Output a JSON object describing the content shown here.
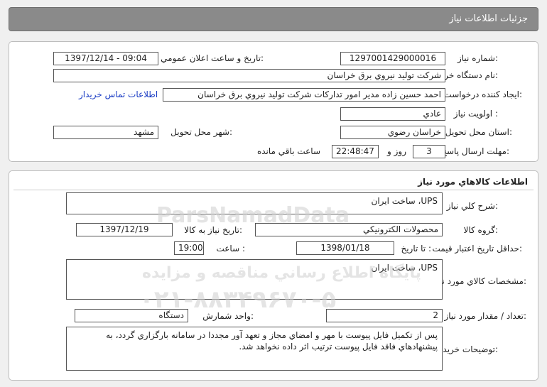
{
  "header": {
    "title": "جزئيات اطلاعات نياز"
  },
  "info": {
    "need_number_label": "شماره نياز:",
    "need_number": "1297001429000016",
    "announce_label": "تاريخ و ساعت اعلان عمومي:",
    "announce_value": "1397/12/14 - 09:04",
    "buyer_org_label": "نام دستگاه خريدار:",
    "buyer_org": "شركت توليد نيروي برق خراسان",
    "requester_label": "ايجاد كننده درخواست:",
    "requester": "احمد حسين زاده مدير امور تداركات شركت توليد نيروي برق خراسان",
    "contact_link": "اطلاعات تماس خريدار",
    "priority_label": "اولويت نياز :",
    "priority": "عادي",
    "province_label": "استان محل تحويل:",
    "province": "خراسان رضوي",
    "city_label": "شهر محل تحويل:",
    "city": "مشهد",
    "deadline_label": "مهلت ارسال پاسخ:",
    "deadline_days": "3",
    "days_word": "روز و",
    "deadline_time": "22:48:47",
    "remaining_word": "ساعت باقي مانده"
  },
  "goods": {
    "section_title": "اطلاعات كالاهاي مورد نياز",
    "summary_label": "شرح كلي نياز:",
    "summary": "UPS، ساخت ايران",
    "group_label": "گروه كالا:",
    "group": "محصولات الكترونيكي",
    "need_date_label": "تاريخ نياز به كالا:",
    "need_date": "1397/12/19",
    "validity_label": "حداقل تاريخ اعتبار قيمت:",
    "until_date_label": "تا تاريخ :",
    "until_date": "1398/01/18",
    "hour_label": "ساعت :",
    "hour": "19:00",
    "spec_label": "مشخصات كالاي مورد نياز:",
    "spec": "UPS، ساخت ايران",
    "qty_label": "تعداد / مقدار مورد نياز:",
    "qty": "2",
    "unit_label": "واحد شمارش:",
    "unit": "دستگاه",
    "notes_label": "توضيحات خريدار:",
    "notes": "پس از تكميل فايل پيوست با مهر و امضاي مجاز و تعهد آور مجددا در سامانه بارگزاري گردد، به پيشنهادهاي فاقد فايل پيوست ترتيب اثر داده نخواهد شد."
  },
  "watermark": {
    "line1": "پايگاه اطلاع رساني مناقصه و مزايده",
    "phone": "۰۲۱-۸۸۳۴۹۶۷۰-۵",
    "brand": "ParsNamadData"
  }
}
